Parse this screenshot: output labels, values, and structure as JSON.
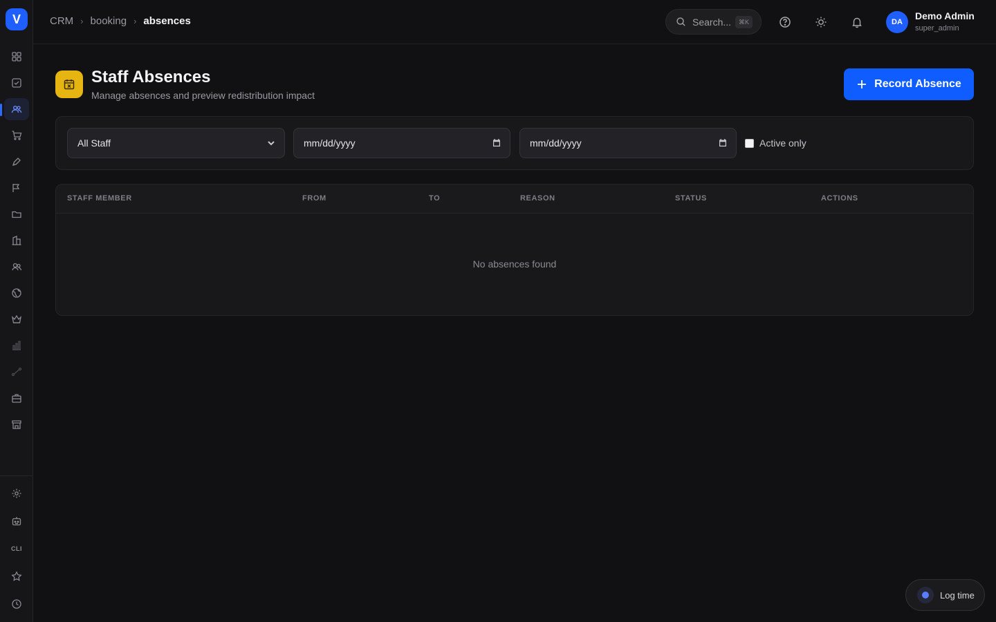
{
  "app": {
    "logo_letter": "V",
    "accent_color": "#0f5cff"
  },
  "sidebar": {
    "items": [
      {
        "name": "dashboard-icon"
      },
      {
        "name": "tasks-icon"
      },
      {
        "name": "users-icon",
        "active": true
      },
      {
        "name": "cart-icon"
      },
      {
        "name": "pen-icon"
      },
      {
        "name": "campaign-icon"
      },
      {
        "name": "folder-icon"
      },
      {
        "name": "building-icon"
      },
      {
        "name": "contacts-icon"
      },
      {
        "name": "globe-icon"
      },
      {
        "name": "crown-icon"
      },
      {
        "name": "chart-icon"
      },
      {
        "name": "route-icon"
      },
      {
        "name": "briefcase-icon"
      },
      {
        "name": "store-icon"
      }
    ],
    "bottom_items": [
      {
        "name": "settings-icon"
      },
      {
        "name": "robot-icon"
      },
      {
        "name": "cli-icon",
        "label": "CLI"
      },
      {
        "name": "star-icon"
      },
      {
        "name": "clock-icon"
      }
    ]
  },
  "topbar": {
    "breadcrumb": [
      "CRM",
      "booking",
      "absences"
    ],
    "search": {
      "placeholder": "Search...",
      "shortcut": "⌘K"
    },
    "user": {
      "initials": "DA",
      "name": "Demo Admin",
      "role": "super_admin"
    }
  },
  "page": {
    "title": "Staff Absences",
    "subtitle": "Manage absences and preview redistribution impact",
    "primary_button": "Record Absence"
  },
  "filters": {
    "staff_select": "All Staff",
    "date_from_placeholder": "mm/dd/yyyy",
    "date_to_placeholder": "mm/dd/yyyy",
    "active_only_label": "Active only",
    "active_only_checked": false
  },
  "table": {
    "columns": [
      "STAFF MEMBER",
      "FROM",
      "TO",
      "REASON",
      "STATUS",
      "ACTIONS"
    ],
    "rows": [],
    "empty_message": "No absences found"
  },
  "floating": {
    "log_time_label": "Log time"
  }
}
